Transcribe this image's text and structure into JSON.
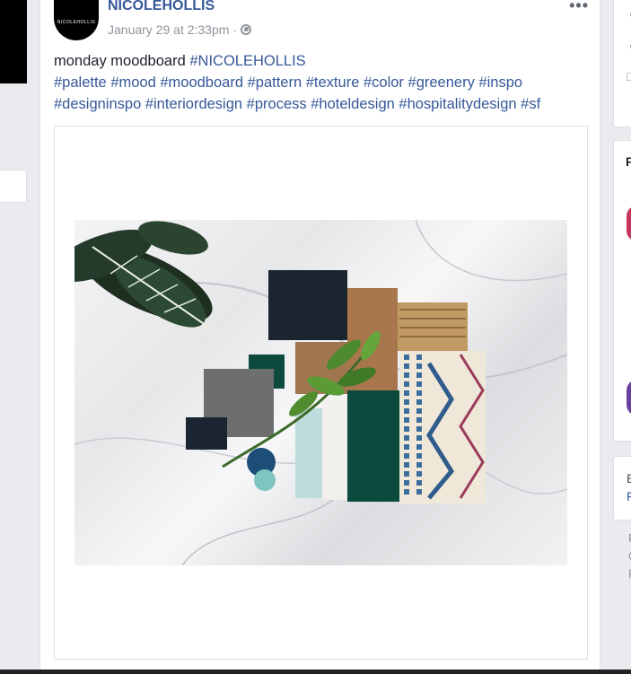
{
  "post": {
    "author": "NICOLEHOLLIS",
    "avatar_text": "NICOLEHOLLIS",
    "timestamp": "January 29 at 2:33pm",
    "separator": "·",
    "more_label": "•••",
    "caption": "monday moodboard ",
    "hashtags_line1": [
      "#NICOLEHOLLIS"
    ],
    "hashtags_line2": [
      "#palette",
      "#mood",
      "#moodboard",
      "#pattern",
      "#texture",
      "#color",
      "#greenery",
      "#inspo"
    ],
    "hashtags_line3": [
      "#designinspo",
      "#interiordesign",
      "#process",
      "#hoteldesign",
      "#hospitalitydesign",
      "#sf"
    ]
  },
  "right_sidebar": {
    "letters": [
      "F",
      "E",
      "F",
      "F",
      "C",
      "F"
    ]
  },
  "colors": {
    "link": "#365899",
    "background": "#e9ebee",
    "teal": "#0f4a3f",
    "navy": "#1a2530"
  },
  "icons": [
    "globe-icon",
    "more-options-icon"
  ]
}
